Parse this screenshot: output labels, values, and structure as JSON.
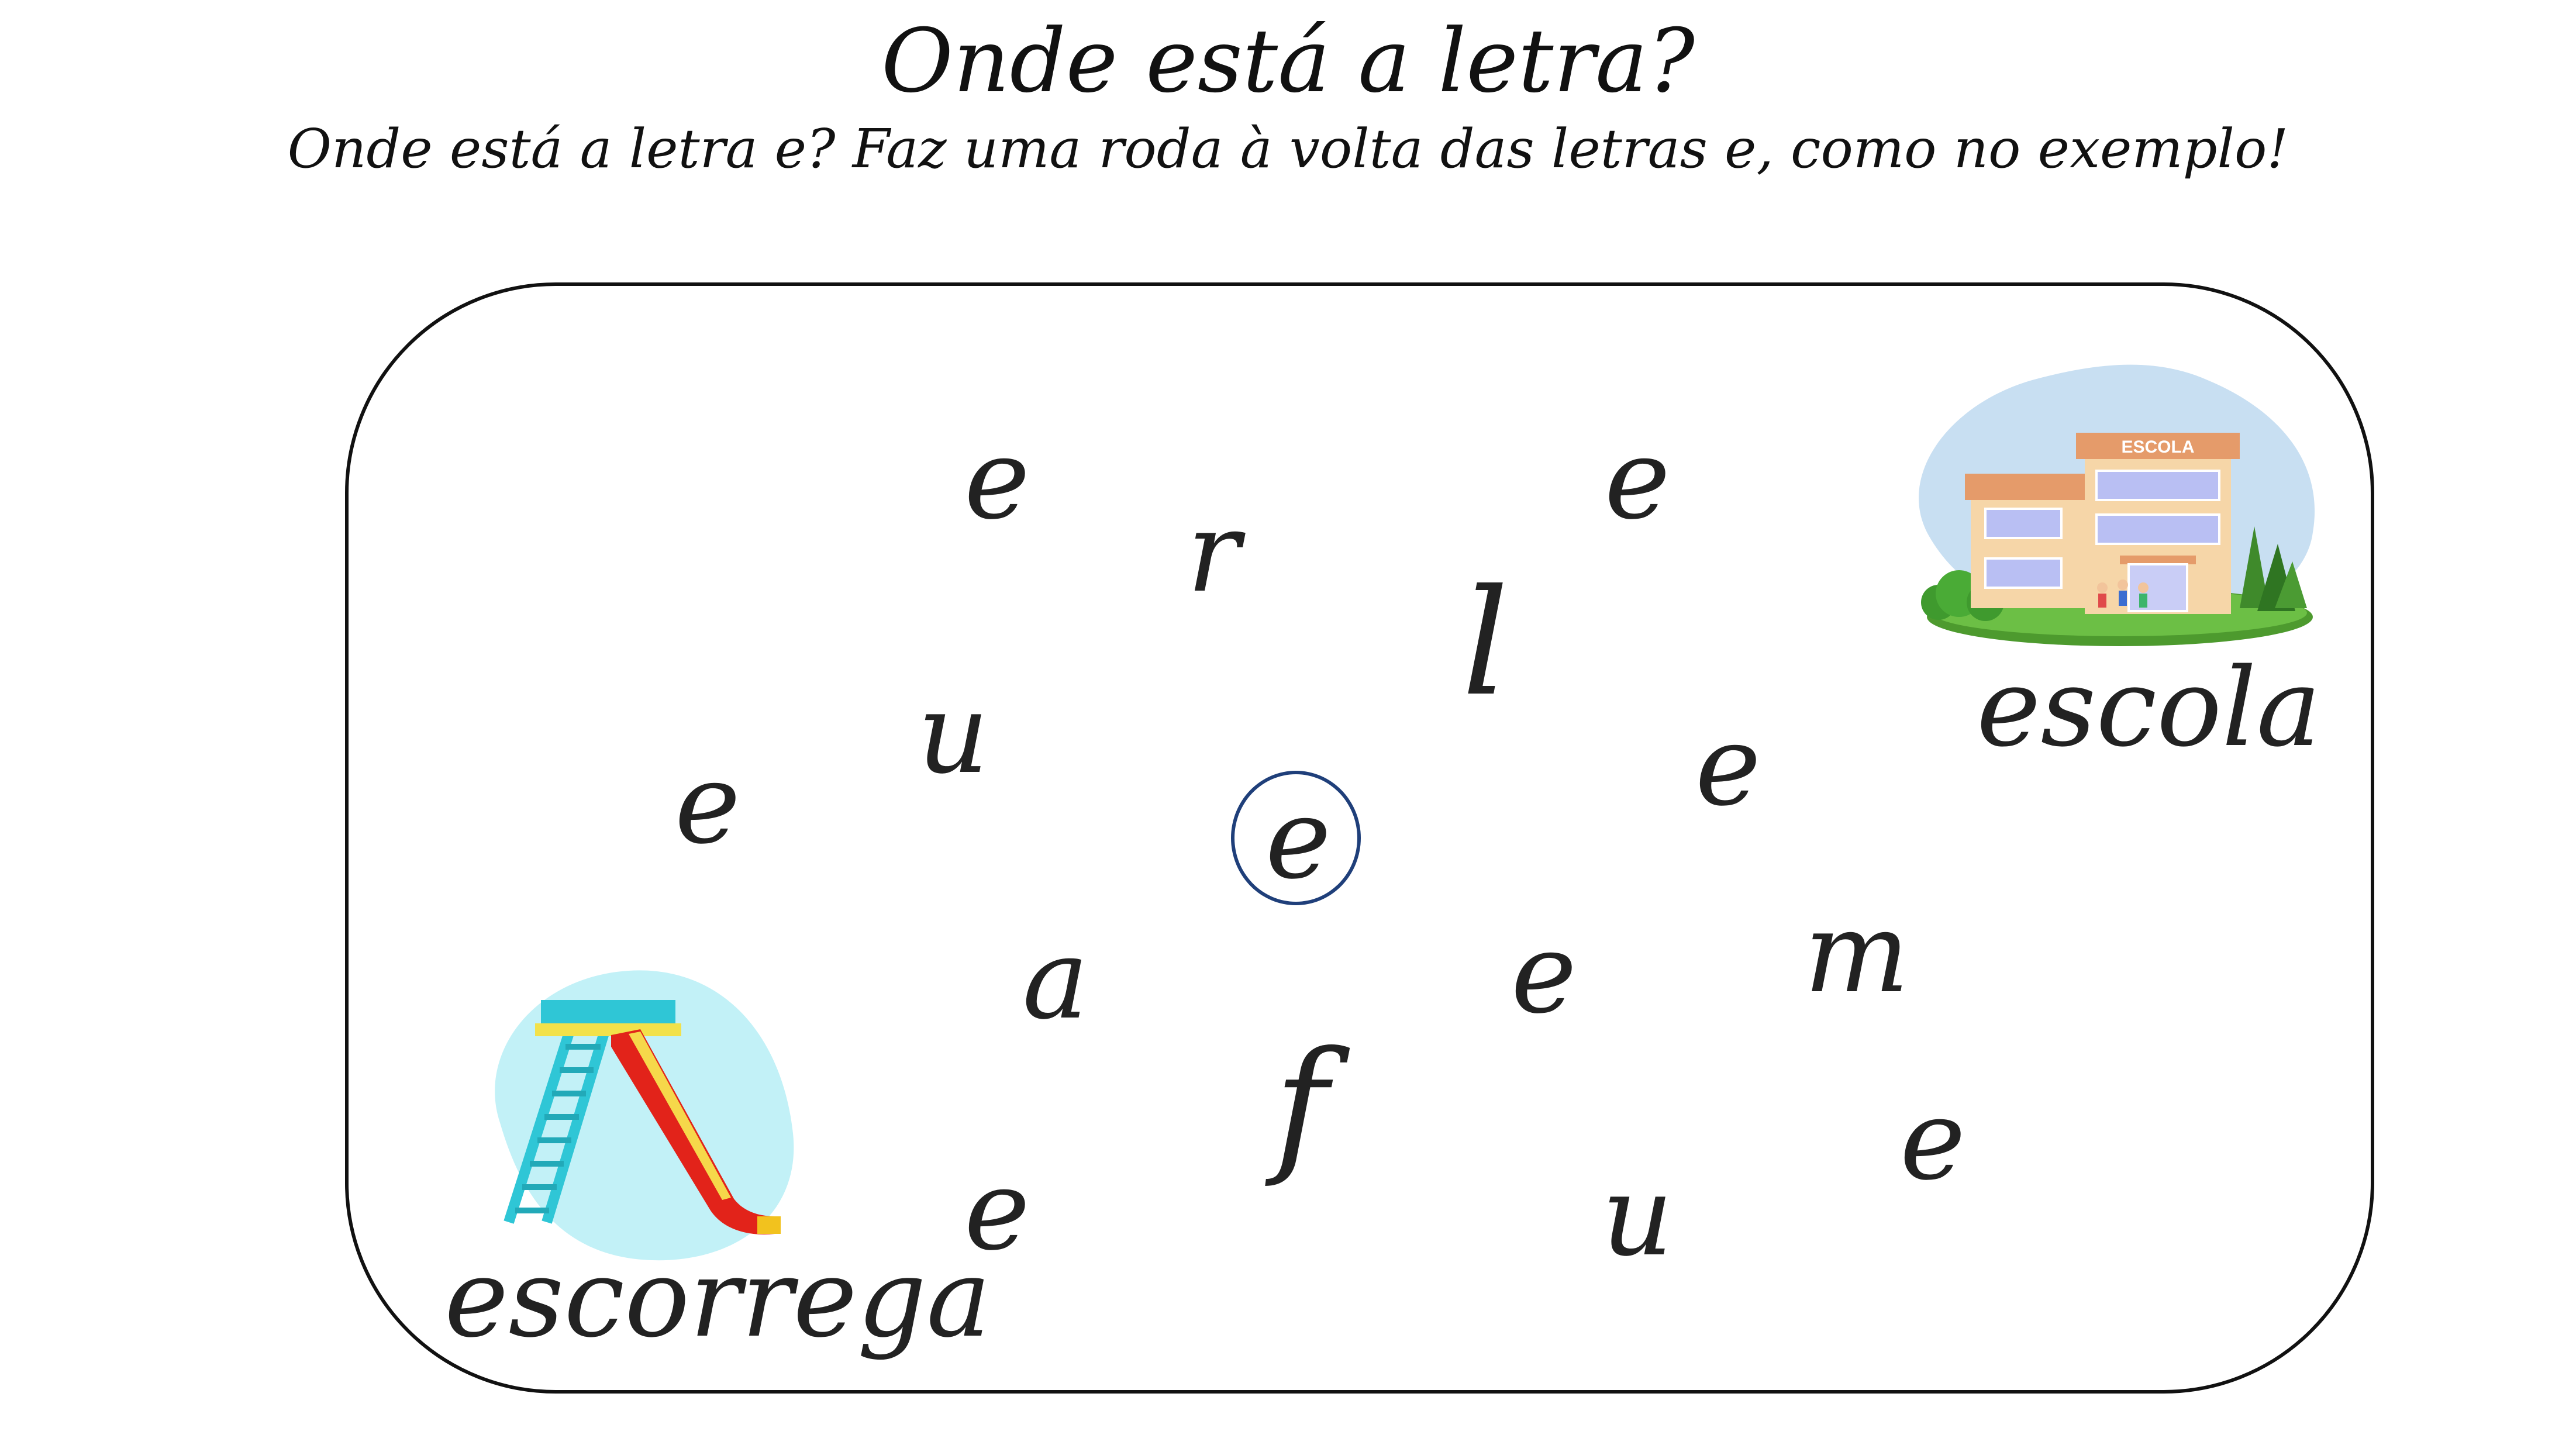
{
  "worksheet": {
    "title": "Onde está a letra?",
    "instruction": "Onde está a letra e? Faz uma roda à volta das letras e, como no exemplo!"
  },
  "board": {
    "letters": [
      "e",
      "r",
      "e",
      "l",
      "u",
      "e",
      "e",
      "e",
      "a",
      "e",
      "m",
      "f",
      "e",
      "e",
      "u"
    ],
    "example_circle_color": "#1f3f7a"
  },
  "pictures": {
    "school": {
      "sign_text": "ESCOLA",
      "caption": "escola",
      "icon": "school-building-icon"
    },
    "slide": {
      "caption": "escorrega",
      "icon": "playground-slide-icon"
    }
  }
}
